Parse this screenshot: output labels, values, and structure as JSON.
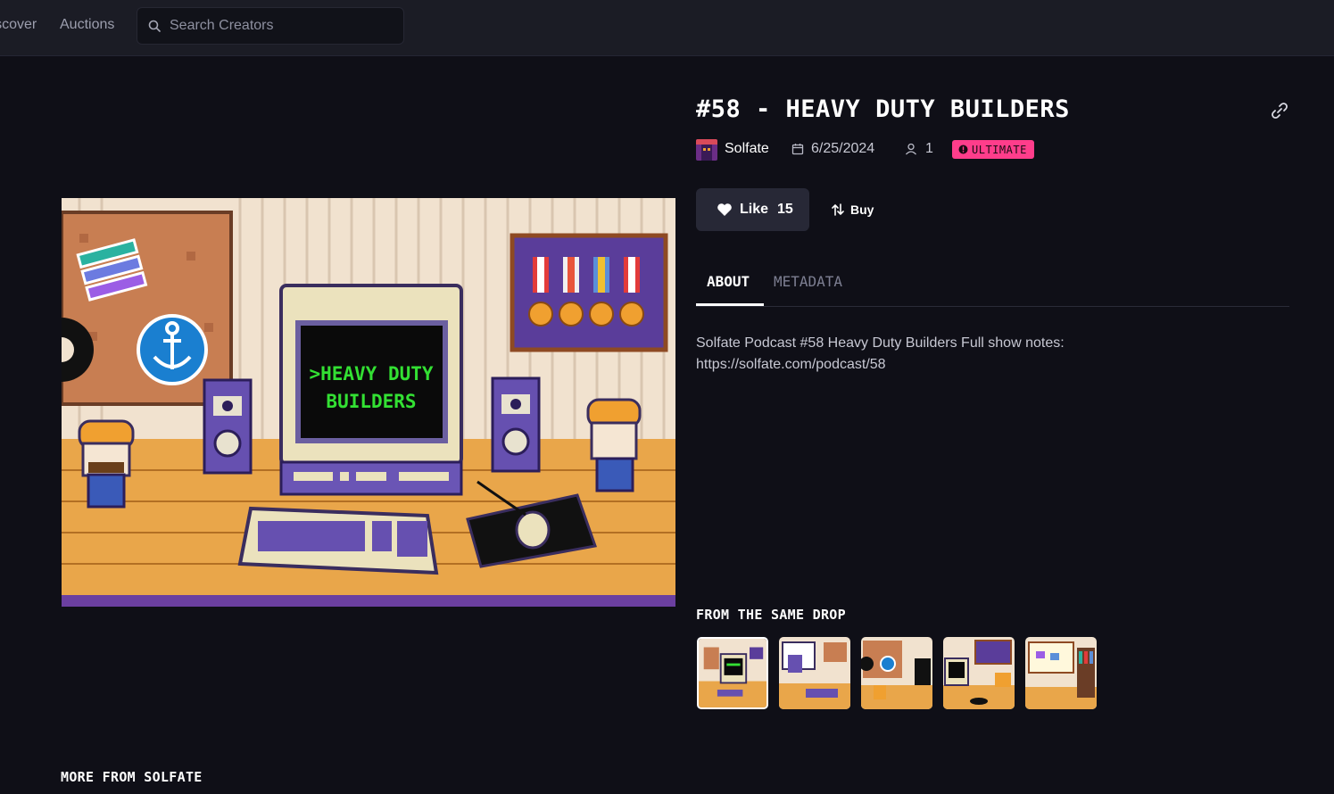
{
  "nav": {
    "discover_label": "Discover",
    "auctions_label": "Auctions",
    "search_placeholder": "Search Creators"
  },
  "artwork": {
    "screen_line_1": ">HEAVY DUTY",
    "screen_line_2": "BUILDERS",
    "icons": [
      "corkboard-icon",
      "anchor-icon",
      "gear-icon",
      "medals-icon",
      "computer-icon",
      "speaker-icon",
      "keyboard-icon",
      "mouse-icon",
      "builder-character-icon"
    ]
  },
  "item": {
    "title": "#58 - HEAVY DUTY BUILDERS",
    "creator": "Solfate",
    "date": "6/25/2024",
    "holders": "1",
    "rarity": "ULTIMATE"
  },
  "actions": {
    "like_label": "Like",
    "like_count": "15",
    "buy_label": "Buy"
  },
  "tabs": [
    {
      "label": "ABOUT",
      "active": true
    },
    {
      "label": "METADATA",
      "active": false
    }
  ],
  "description": "Solfate Podcast #58 Heavy Duty Builders Full show notes: https://solfate.com/podcast/58",
  "sections": {
    "same_drop": "FROM THE SAME DROP",
    "more_from": "MORE FROM SOLFATE"
  },
  "colors": {
    "background": "#0f0f17",
    "nav": "#1b1c25",
    "badge": "#ff3d8b",
    "screen_text": "#33e033",
    "purple": "#5b3f9c",
    "wood": "#e9a64a"
  }
}
